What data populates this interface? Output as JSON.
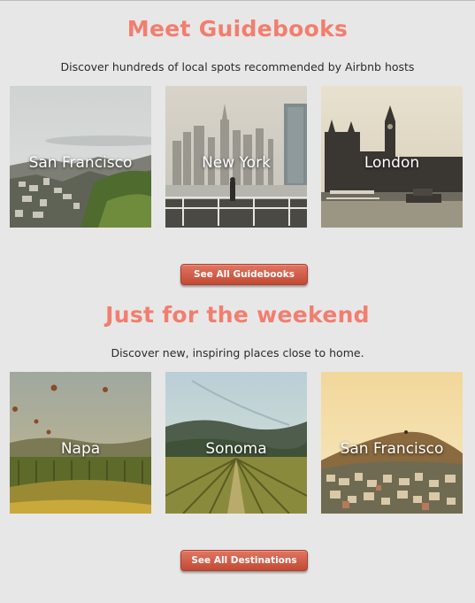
{
  "guidebooks": {
    "title": "Meet Guidebooks",
    "subtitle": "Discover hundreds of local spots recommended by Airbnb hosts",
    "cards": [
      {
        "label": "San Francisco",
        "image": "foggy-hillside-city-photo"
      },
      {
        "label": "New York",
        "image": "skyline-pier-photo"
      },
      {
        "label": "London",
        "image": "big-ben-river-photo"
      }
    ],
    "button_label": "See All Guidebooks"
  },
  "weekend": {
    "title": "Just for the weekend",
    "subtitle": "Discover new, inspiring places close to home.",
    "cards": [
      {
        "label": "Napa",
        "image": "vineyard-hot-air-balloons-photo"
      },
      {
        "label": "Sonoma",
        "image": "vineyard-rows-hills-photo"
      },
      {
        "label": "San Francisco",
        "image": "hill-city-sunset-photo"
      }
    ],
    "button_label": "See All Destinations"
  },
  "colors": {
    "accent": "#f27e6f",
    "button": "#c9553f",
    "background": "#e7e7e7"
  }
}
